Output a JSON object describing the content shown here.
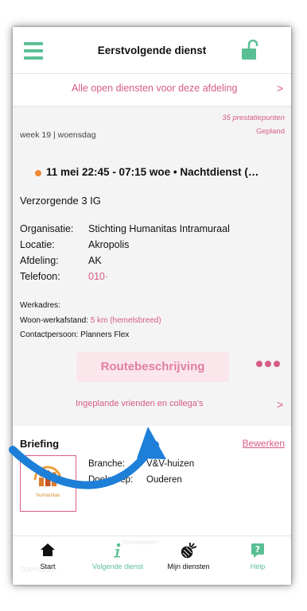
{
  "header": {
    "title": "Eerstvolgende dienst"
  },
  "open_shifts_link": {
    "label": "Alle open diensten voor deze afdeling",
    "chevron": ">"
  },
  "shift": {
    "points": "35 prestatiepunten",
    "status": "Gepland",
    "week_day": "week 19 | woensdag",
    "title": "11 mei 22:45 - 07:15 woe • Nachtdienst (…",
    "role": "Verzorgende 3 IG",
    "details": [
      {
        "label": "Organisatie:",
        "value": "Stichting Humanitas Intramuraal"
      },
      {
        "label": "Locatie:",
        "value": "Akropolis"
      },
      {
        "label": "Afdeling:",
        "value": "AK"
      },
      {
        "label": "Telefoon:",
        "value": "010·"
      }
    ],
    "work_address_label": "Werkadres:",
    "commute_label": "Woon-werkafstand:",
    "commute_value": "5 km (hemelsbreed)",
    "contact_label": "Contactpersoon:",
    "contact_value": "Planners Flex",
    "route_button": "Routebeschrijving",
    "friends_link": "Ingeplande vrienden en collega's",
    "chevron": ">"
  },
  "briefing": {
    "title": "Briefing",
    "edit": "Bewerken",
    "logo_text": "humanitas",
    "rows": [
      {
        "label": "Branche:",
        "value": "V&V-huizen"
      },
      {
        "label": "Doelgroep:",
        "value": "Ouderen"
      }
    ]
  },
  "tabbar": {
    "ghost_text_1": "Voorwaarden",
    "ghost_text_2": "COPYRIGHT",
    "tabs": [
      {
        "label": "Start",
        "icon": "home-icon",
        "color": "#111111"
      },
      {
        "label": "Volgende dienst",
        "icon": "info-icon",
        "color": "#5bbf94"
      },
      {
        "label": "Mijn diensten",
        "icon": "pineapple-icon",
        "color": "#111111"
      },
      {
        "label": "Help",
        "icon": "help-icon",
        "color": "#5bbf94"
      }
    ]
  },
  "colors": {
    "accent_green": "#5bbf94",
    "accent_pink": "#d65c86",
    "arrow_blue": "#1e7fd8"
  }
}
